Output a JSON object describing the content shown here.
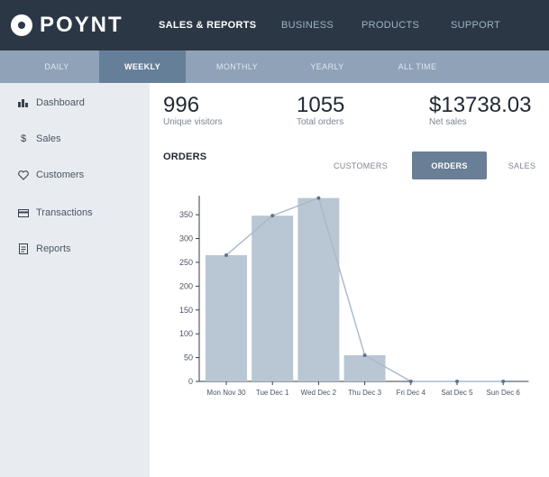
{
  "brand": {
    "name": "POYNT"
  },
  "topnav": [
    {
      "label": "SALES & REPORTS",
      "active": true
    },
    {
      "label": "BUSINESS",
      "active": false
    },
    {
      "label": "PRODUCTS",
      "active": false
    },
    {
      "label": "SUPPORT",
      "active": false
    }
  ],
  "periods": [
    {
      "label": "DAILY",
      "active": false
    },
    {
      "label": "WEEKLY",
      "active": true
    },
    {
      "label": "MONTHLY",
      "active": false
    },
    {
      "label": "YEARLY",
      "active": false
    },
    {
      "label": "ALL TIME",
      "active": false
    }
  ],
  "sidebar": {
    "items": [
      {
        "label": "Dashboard",
        "icon": "bar-chart-icon"
      },
      {
        "label": "Sales",
        "icon": "dollar-icon"
      },
      {
        "label": "Customers",
        "icon": "heart-icon"
      },
      {
        "label": "Transactions",
        "icon": "card-icon"
      },
      {
        "label": "Reports",
        "icon": "document-icon"
      }
    ]
  },
  "stats": [
    {
      "value": "996",
      "label": "Unique visitors"
    },
    {
      "value": "1055",
      "label": "Total orders"
    },
    {
      "value": "$13738.03",
      "label": "Net sales"
    }
  ],
  "section": {
    "title": "ORDERS"
  },
  "chart_tabs": [
    {
      "label": "CUSTOMERS",
      "active": false
    },
    {
      "label": "ORDERS",
      "active": true
    },
    {
      "label": "SALES",
      "active": false
    }
  ],
  "colors": {
    "topbar": "#2b3744",
    "subbar": "#8fa2b8",
    "bar": "#b9c6d4",
    "line": "#a9b8c8",
    "accent": "#687f96"
  },
  "chart_data": {
    "type": "bar",
    "categories": [
      "Mon Nov 30",
      "Tue Dec 1",
      "Wed Dec 2",
      "Thu Dec 3",
      "Fri Dec 4",
      "Sat Dec 5",
      "Sun Dec 6"
    ],
    "values": [
      265,
      348,
      385,
      55,
      0,
      0,
      0
    ],
    "line_overlay": true,
    "yticks": [
      0,
      50,
      100,
      150,
      200,
      250,
      300,
      350
    ],
    "ylim": [
      0,
      390
    ],
    "grid": false
  }
}
